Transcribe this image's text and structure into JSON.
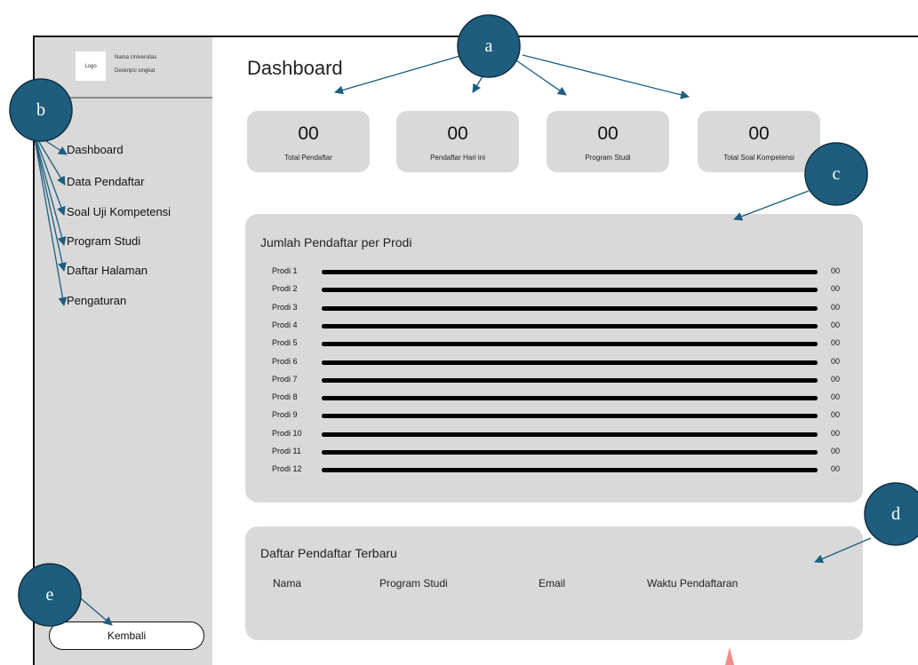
{
  "brand": {
    "logo": "Logo",
    "university_name": "Nama Universitas",
    "description": "Deskripsi singkat"
  },
  "sidebar": {
    "items": [
      {
        "label": "Dashboard"
      },
      {
        "label": "Data Pendaftar"
      },
      {
        "label": "Soal Uji Kompetensi"
      },
      {
        "label": "Program Studi"
      },
      {
        "label": "Daftar Halaman"
      },
      {
        "label": "Pengaturan"
      }
    ],
    "back_label": "Kembali"
  },
  "page_title": "Dashboard",
  "stats": [
    {
      "value": "00",
      "label": "Total Pendaftar"
    },
    {
      "value": "00",
      "label": "Pendaftar Hari ini"
    },
    {
      "value": "00",
      "label": "Program Studi"
    },
    {
      "value": "00",
      "label": "Total Soal Kompetensi"
    }
  ],
  "chart_data": {
    "type": "bar",
    "title": "Jumlah Pendaftar per Prodi",
    "categories": [
      "Prodi 1",
      "Prodi 2",
      "Prodi 3",
      "Prodi 4",
      "Prodi 5",
      "Prodi 6",
      "Prodi 7",
      "Prodi 8",
      "Prodi 9",
      "Prodi 10",
      "Prodi 11",
      "Prodi 12"
    ],
    "value_labels": [
      "00",
      "00",
      "00",
      "00",
      "00",
      "00",
      "00",
      "00",
      "00",
      "00",
      "00",
      "00"
    ],
    "fill": [
      1,
      1,
      1,
      1,
      1,
      1,
      1,
      1,
      1,
      1,
      1,
      1
    ]
  },
  "recent": {
    "title": "Daftar Pendaftar Terbaru",
    "columns": [
      "Nama",
      "Program Studi",
      "Email",
      "Waktu Pendaftaran"
    ]
  },
  "callouts": [
    {
      "label": "a"
    },
    {
      "label": "b"
    },
    {
      "label": "c"
    },
    {
      "label": "d"
    },
    {
      "label": "e"
    }
  ],
  "colors": {
    "sidebar_bg": "#d9d9d9",
    "card_bg": "#d9d9d9",
    "callout_fill": "#1e5d7e",
    "arrow": "#1e5d7e",
    "marker": "#f28b8b"
  }
}
